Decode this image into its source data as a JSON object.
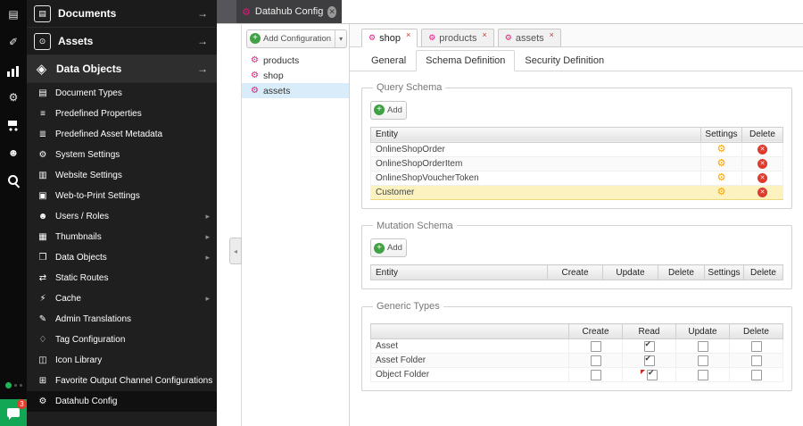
{
  "window": {
    "tab_label": "Datahub Config"
  },
  "iconbar": {
    "icons": [
      {
        "name": "documents-icon"
      },
      {
        "name": "tools-icon"
      },
      {
        "name": "reports-icon"
      },
      {
        "name": "settings-icon"
      },
      {
        "name": "ecommerce-icon"
      },
      {
        "name": "users-icon"
      },
      {
        "name": "search-icon"
      }
    ],
    "chat_badge": "3"
  },
  "sidebar": {
    "sections": [
      {
        "label": "Documents",
        "icon": "documents-box-icon"
      },
      {
        "label": "Assets",
        "icon": "assets-box-icon"
      },
      {
        "label": "Data Objects",
        "icon": "data-objects-box-icon",
        "active": true
      }
    ],
    "items": [
      {
        "label": "Document Types",
        "icon": "document-types-icon"
      },
      {
        "label": "Predefined Properties",
        "icon": "predefined-properties-icon"
      },
      {
        "label": "Predefined Asset Metadata",
        "icon": "asset-metadata-icon"
      },
      {
        "label": "System Settings",
        "icon": "system-settings-icon"
      },
      {
        "label": "Website Settings",
        "icon": "website-settings-icon"
      },
      {
        "label": "Web-to-Print Settings",
        "icon": "web-to-print-icon"
      },
      {
        "label": "Users / Roles",
        "icon": "users-roles-icon",
        "has_children": true
      },
      {
        "label": "Thumbnails",
        "icon": "thumbnails-icon",
        "has_children": true
      },
      {
        "label": "Data Objects",
        "icon": "data-objects-icon",
        "has_children": true
      },
      {
        "label": "Static Routes",
        "icon": "static-routes-icon"
      },
      {
        "label": "Cache",
        "icon": "cache-icon",
        "has_children": true
      },
      {
        "label": "Admin Translations",
        "icon": "translations-icon"
      },
      {
        "label": "Tag Configuration",
        "icon": "tag-icon"
      },
      {
        "label": "Icon Library",
        "icon": "icon-library-icon"
      },
      {
        "label": "Favorite Output Channel Configurations",
        "icon": "favorites-grid-icon"
      },
      {
        "label": "Datahub Config",
        "icon": "datahub-gear-icon",
        "selected": true
      }
    ]
  },
  "tree": {
    "add_button": {
      "label": "Add Configuration"
    },
    "items": [
      {
        "label": "products"
      },
      {
        "label": "shop"
      },
      {
        "label": "assets",
        "selected": true
      }
    ]
  },
  "editor": {
    "tabs": [
      {
        "label": "shop",
        "active": true
      },
      {
        "label": "products"
      },
      {
        "label": "assets"
      }
    ],
    "subtabs": [
      {
        "label": "General"
      },
      {
        "label": "Schema Definition",
        "active": true
      },
      {
        "label": "Security Definition"
      }
    ],
    "query_schema": {
      "legend": "Query Schema",
      "add_label": "Add",
      "columns": [
        "Entity",
        "Settings",
        "Delete"
      ],
      "rows": [
        {
          "entity": "OnlineShopOrder"
        },
        {
          "entity": "OnlineShopOrderItem"
        },
        {
          "entity": "OnlineShopVoucherToken"
        },
        {
          "entity": "Customer",
          "selected": true
        }
      ]
    },
    "mutation_schema": {
      "legend": "Mutation Schema",
      "add_label": "Add",
      "columns": [
        "Entity",
        "Create",
        "Update",
        "Delete",
        "Settings",
        "Delete"
      ],
      "rows": []
    },
    "generic_types": {
      "legend": "Generic Types",
      "columns": [
        "",
        "Create",
        "Read",
        "Update",
        "Delete"
      ],
      "rows": [
        {
          "label": "Asset",
          "create": false,
          "read": true,
          "update": false,
          "delete": false
        },
        {
          "label": "Asset Folder",
          "create": false,
          "read": true,
          "update": false,
          "delete": false
        },
        {
          "label": "Object Folder",
          "create": false,
          "read": true,
          "update": false,
          "delete": false,
          "read_dirty": true
        }
      ]
    }
  },
  "colors": {
    "accent_green": "#3fa142",
    "brand_magenta": "#e5127d",
    "selected_row_yellow": "#fcf2bf",
    "delete_red": "#dd3b2f",
    "settings_gear_yellow": "#f0a30a",
    "selected_tree_blue": "#d9ecf9"
  }
}
